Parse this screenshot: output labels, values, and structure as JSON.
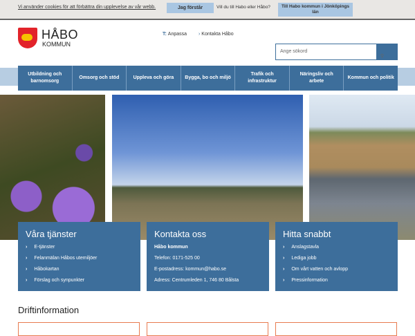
{
  "cookie": {
    "message": "Vi använder cookies för att förbättra din upplevelse av vår webb.",
    "accept": "Jag förstår",
    "question": "Vill du till Habo eller Håbo?",
    "habo_link": "Till Habo kommun i Jönköpings län"
  },
  "logo": {
    "line1": "HÅBO",
    "line2": "KOMMUN"
  },
  "top_links": {
    "customize": "Anpassa",
    "contact": "Kontakta Håbo"
  },
  "search": {
    "placeholder": "Ange sökord"
  },
  "nav": [
    "Utbildning och barnomsorg",
    "Omsorg och stöd",
    "Uppleva och göra",
    "Bygga, bo och miljö",
    "Trafik och infrastruktur",
    "Näringsliv och arbete",
    "Kommun och politik"
  ],
  "cards": {
    "services": {
      "title": "Våra tjänster",
      "items": [
        "E-tjänster",
        "Felanmälan Håbos utemiljöer",
        "Håbokartan",
        "Förslag och synpunkter"
      ]
    },
    "contact": {
      "title": "Kontakta oss",
      "name": "Håbo kommun",
      "phone": "Telefon: 0171-525 00",
      "email": "E-postadress: kommun@habo.se",
      "address": "Adress: Centrumleden 1, 746 80 Bålsta"
    },
    "quick": {
      "title": "Hitta snabbt",
      "items": [
        "Anslagstavla",
        "Lediga jobb",
        "Om vårt vatten och avlopp",
        "Pressinformation"
      ]
    }
  },
  "drift_heading": "Driftinformation"
}
